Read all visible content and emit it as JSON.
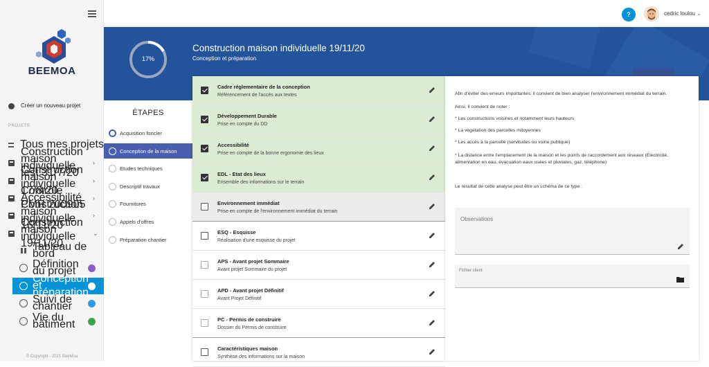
{
  "brand": {
    "name": "BEEMOA"
  },
  "sidebar": {
    "create_label": "Créer un nouveau projet",
    "section_label": "PROJETS",
    "all_projects": "Tous mes projets",
    "projects": [
      "Construction maison individuelle test 31/7/20",
      "Construction maison individuelle 17/8/20",
      "Contrôle Accessibilité PMR 200905",
      "Construction maison individuelle 16/11/20",
      "Construction maison individuelle 19/11/20"
    ],
    "subnav": {
      "dashboard": "Tableau de bord",
      "phases": [
        {
          "label": "Définition du projet",
          "color": "#8e5cc8"
        },
        {
          "label": "Conception et préparation",
          "color": "#ffffff"
        },
        {
          "label": "Suivi de chantier",
          "color": "#2e9be6"
        },
        {
          "label": "Vie du bâtiment",
          "color": "#3aa548"
        }
      ]
    },
    "copyright": "© Copyright - 2021 BeeMoa"
  },
  "topbar": {
    "help": "?",
    "user_name": "cedric loulou"
  },
  "header": {
    "progress_value": 17,
    "progress_label": "17%",
    "title": "Construction maison individuelle 19/11/20",
    "subtitle": "Conception et préparation"
  },
  "etapes": {
    "heading": "ÉTAPES",
    "steps": [
      "Acquisition foncier",
      "Conception de la maison",
      "Etudes techniques",
      "Descriptif travaux",
      "Fournitures",
      "Appels d'offres",
      "Préparation chantier"
    ]
  },
  "tasks": [
    {
      "title": "Cadre réglementaire de la conception",
      "sub": "Référencement de l'accès aux textes",
      "state": "done"
    },
    {
      "title": "Développement Durable",
      "sub": "Prise en compte du DD",
      "state": "done"
    },
    {
      "title": "Accessibilité",
      "sub": "Prise en compte de la bonne ergonomie des lieux",
      "state": "done"
    },
    {
      "title": "EDL - Etat des lieux",
      "sub": "Ensemble des informations sur le terrain",
      "state": "done"
    },
    {
      "title": "Environnement immédiat",
      "sub": "Prise en compte de l'environnement immédiat du terrain",
      "state": "current"
    },
    {
      "title": "ESQ - Esquisse",
      "sub": "Réalisation d'une esquisse du projet",
      "state": "todo"
    },
    {
      "title": "APS - Avant projet Sommaire",
      "sub": "Avant projet Sommaire du projet",
      "state": "todo"
    },
    {
      "title": "APD - Avant projet Définitif",
      "sub": "Avant Projet Définitif",
      "state": "todo"
    },
    {
      "title": "PC - Permis de construire",
      "sub": "Dossier du Permis de construire",
      "state": "todo"
    },
    {
      "title": "Caractéristiques maison",
      "sub": "Synthèse des informations sur la maison",
      "state": "todo"
    }
  ],
  "detail": {
    "p1": "Afin d'éviter des erreurs importantes, il convient de bien analyser l'environnement immédiat du terrain.",
    "p2": "Ainsi, il convient de noter :",
    "b1": "* Les constructions voisines et notamment leurs hauteurs",
    "b2": "* La végétation des parcelles mitoyennes",
    "b3": "* Les accès à la parcelle (servitudes ou voirie publique)",
    "b4": "* La distance entre l'emplacement de la maison et les points de raccordement aux réseaux (Electricité, alimentation en eau, évacuation eaux usées et pluviales, gaz, téléphone)",
    "p3": "Le résultat de cette analyse peut être un schéma de ce type :",
    "observations_placeholder": "Observations",
    "fichier_label": "Fichier client"
  }
}
